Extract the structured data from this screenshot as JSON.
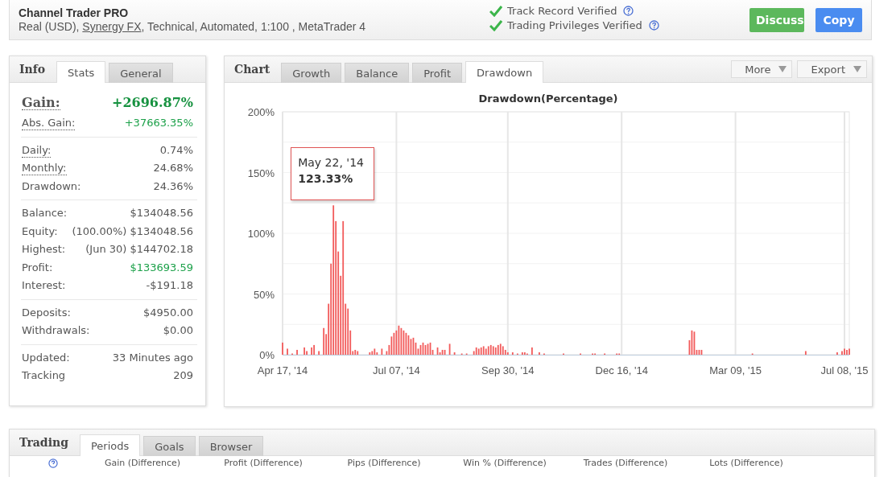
{
  "header": {
    "title": "Channel Trader PRO",
    "subtitle": {
      "before": "Real (USD), ",
      "link": "Synergy FX",
      "after": ", Technical, Automated, 1:100 , MetaTrader 4"
    },
    "verifications": [
      {
        "label": "Track Record Verified",
        "verified": true
      },
      {
        "label": "Trading Privileges Verified",
        "verified": true
      }
    ],
    "buttons": [
      {
        "label": "Discuss",
        "kind": "discuss"
      },
      {
        "label": "Copy",
        "kind": "copy"
      }
    ]
  },
  "info": {
    "heading": "Info",
    "tabs": [
      {
        "label": "Stats",
        "selected": true
      },
      {
        "label": "General",
        "selected": false
      }
    ],
    "groups": [
      {
        "rows": [
          {
            "label": "Gain:",
            "value": "+2696.87%",
            "hint": true,
            "positive": true,
            "big": true
          },
          {
            "label": "Abs. Gain:",
            "value": "+37663.35%",
            "hint": true,
            "positive": true,
            "big": false
          }
        ]
      },
      {
        "rows": [
          {
            "label": "Daily:",
            "value": "0.74%",
            "hint": true,
            "positive": false,
            "big": false
          },
          {
            "label": "Monthly:",
            "value": "24.68%",
            "hint": true,
            "positive": false,
            "big": false
          },
          {
            "label": "Drawdown:",
            "value": "24.36%",
            "hint": false,
            "positive": false,
            "big": false
          }
        ]
      },
      {
        "rows": [
          {
            "label": "Balance:",
            "value": "$134048.56",
            "hint": false,
            "positive": false,
            "big": false
          },
          {
            "label": "Equity:",
            "note": "(100.00%)",
            "value": "$134048.56",
            "hint": false,
            "positive": false,
            "big": false
          },
          {
            "label": "Highest:",
            "note": "(Jun 30)",
            "value": "$144702.18",
            "hint": false,
            "positive": false,
            "big": false
          },
          {
            "label": "Profit:",
            "value": "$133693.59",
            "hint": false,
            "positive": true,
            "big": false
          },
          {
            "label": "Interest:",
            "value": "-$191.18",
            "hint": false,
            "positive": false,
            "big": false
          }
        ]
      },
      {
        "rows": [
          {
            "label": "Deposits:",
            "value": "$4950.00",
            "hint": false,
            "positive": false,
            "big": false
          },
          {
            "label": "Withdrawals:",
            "value": "$0.00",
            "hint": false,
            "positive": false,
            "big": false
          }
        ]
      },
      {
        "rows": [
          {
            "label": "Updated:",
            "value": "33 Minutes ago",
            "hint": false,
            "positive": false,
            "big": false
          },
          {
            "label": "Tracking",
            "value": "209",
            "hint": false,
            "positive": false,
            "big": false
          }
        ]
      }
    ]
  },
  "chart": {
    "heading": "Chart",
    "tabs": [
      {
        "label": "Growth",
        "selected": false
      },
      {
        "label": "Balance",
        "selected": false
      },
      {
        "label": "Profit",
        "selected": false
      },
      {
        "label": "Drawdown",
        "selected": true
      }
    ],
    "menus": [
      {
        "label": "More"
      },
      {
        "label": "Export"
      }
    ],
    "tooltip": {
      "date": "May 22, '14",
      "value": "123.33%"
    },
    "chart_data": {
      "type": "bar",
      "title": "Drawdown(Percentage)",
      "grid": true,
      "ylim": [
        0,
        200
      ],
      "categories": [
        "Apr 17, '14",
        null,
        null,
        null,
        null,
        null,
        null,
        null,
        null,
        null,
        null,
        null,
        null,
        null,
        null,
        null,
        null,
        null,
        null,
        null,
        null,
        null,
        null,
        null,
        null,
        null,
        null,
        null,
        null,
        null,
        null,
        null,
        null,
        null,
        null,
        null,
        null,
        null,
        null,
        null,
        null,
        null,
        null,
        null,
        null,
        null,
        null,
        "Jul 07, '14",
        null,
        null,
        null,
        null,
        null,
        null,
        null,
        null,
        null,
        null,
        null,
        null,
        null,
        null,
        null,
        null,
        null,
        null,
        null,
        null,
        null,
        null,
        null,
        null,
        null,
        null,
        null,
        null,
        null,
        null,
        null,
        null,
        null,
        null,
        null,
        null,
        null,
        null,
        null,
        null,
        null,
        null,
        null,
        null,
        null,
        "Sep 30, '14",
        null,
        null,
        null,
        null,
        null,
        null,
        null,
        null,
        null,
        null,
        null,
        null,
        null,
        null,
        null,
        null,
        null,
        null,
        null,
        null,
        null,
        null,
        null,
        null,
        null,
        null,
        null,
        null,
        null,
        null,
        null,
        null,
        null,
        null,
        null,
        null,
        null,
        null,
        null,
        null,
        null,
        null,
        null,
        null,
        null,
        null,
        "Dec 16, '14",
        null,
        null,
        null,
        null,
        null,
        null,
        null,
        null,
        null,
        null,
        null,
        null,
        null,
        null,
        null,
        null,
        null,
        null,
        null,
        null,
        null,
        null,
        null,
        null,
        null,
        null,
        null,
        null,
        null,
        null,
        null,
        null,
        null,
        null,
        null,
        null,
        null,
        null,
        null,
        null,
        null,
        null,
        null,
        null,
        null,
        null,
        "Mar 09, '15",
        null,
        null,
        null,
        null,
        null,
        null,
        null,
        null,
        null,
        null,
        null,
        null,
        null,
        null,
        null,
        null,
        null,
        null,
        null,
        null,
        null,
        null,
        null,
        null,
        null,
        null,
        null,
        null,
        null,
        null,
        null,
        null,
        null,
        null,
        null,
        null,
        null,
        null,
        null,
        null,
        null,
        null,
        null,
        null,
        "Jul 08, '15",
        null,
        null
      ],
      "yticks": [
        {
          "value": 0,
          "label": "0%"
        },
        {
          "value": 50,
          "label": "50%"
        },
        {
          "value": 100,
          "label": "100%"
        },
        {
          "value": 150,
          "label": "150%"
        },
        {
          "value": 200,
          "label": "200%"
        }
      ],
      "series": [
        {
          "color": "#f25a5a",
          "values": [
            10,
            null,
            5,
            null,
            1,
            null,
            4,
            null,
            null,
            6,
            3,
            null,
            6,
            8,
            null,
            3,
            null,
            22,
            17,
            42,
            75,
            123,
            110,
            85,
            65,
            110,
            42,
            38,
            20,
            3,
            4,
            3,
            null,
            null,
            null,
            null,
            2,
            3,
            5,
            2,
            null,
            5,
            null,
            3,
            8,
            15,
            18,
            20,
            24,
            22,
            20,
            18,
            16,
            13,
            14,
            10,
            5,
            8,
            10,
            8,
            9,
            10,
            4,
            null,
            6,
            2,
            4,
            4,
            null,
            9,
            null,
            2,
            null,
            null,
            1,
            null,
            1,
            null,
            null,
            3,
            6,
            5,
            6,
            7,
            5,
            7,
            8,
            7,
            6,
            8,
            9,
            7,
            4,
            2,
            null,
            2,
            null,
            1,
            null,
            2,
            2,
            1,
            null,
            6,
            null,
            null,
            2,
            null,
            1,
            null,
            null,
            null,
            null,
            null,
            null,
            null,
            1,
            null,
            null,
            null,
            null,
            null,
            null,
            1,
            null,
            null,
            null,
            null,
            1,
            1,
            null,
            null,
            null,
            1,
            null,
            null,
            null,
            null,
            1,
            1,
            null,
            null,
            null,
            null,
            null,
            null,
            null,
            null,
            null,
            null,
            null,
            null,
            null,
            null,
            null,
            null,
            null,
            null,
            null,
            null,
            null,
            null,
            null,
            null,
            null,
            null,
            null,
            null,
            12,
            20,
            19,
            4,
            4,
            4,
            null,
            null,
            null,
            null,
            null,
            null,
            null,
            null,
            null,
            null,
            null,
            null,
            null,
            null,
            null,
            null,
            null,
            null,
            null,
            null,
            1,
            null,
            null,
            null,
            null,
            null,
            null,
            null,
            null,
            null,
            null,
            null,
            null,
            null,
            null,
            null,
            null,
            null,
            null,
            null,
            null,
            null,
            3,
            null,
            null,
            null,
            null,
            null,
            null,
            null,
            null,
            null,
            null,
            null,
            null,
            2,
            null,
            3,
            5,
            4,
            5
          ]
        }
      ]
    }
  },
  "trading": {
    "heading": "Trading",
    "tabs": [
      {
        "label": "Periods",
        "selected": true
      },
      {
        "label": "Goals",
        "selected": false
      },
      {
        "label": "Browser",
        "selected": false
      }
    ],
    "columns": [
      "Gain (Difference)",
      "Profit (Difference)",
      "Pips (Difference)",
      "Win % (Difference)",
      "Trades (Difference)",
      "Lots (Difference)"
    ]
  }
}
